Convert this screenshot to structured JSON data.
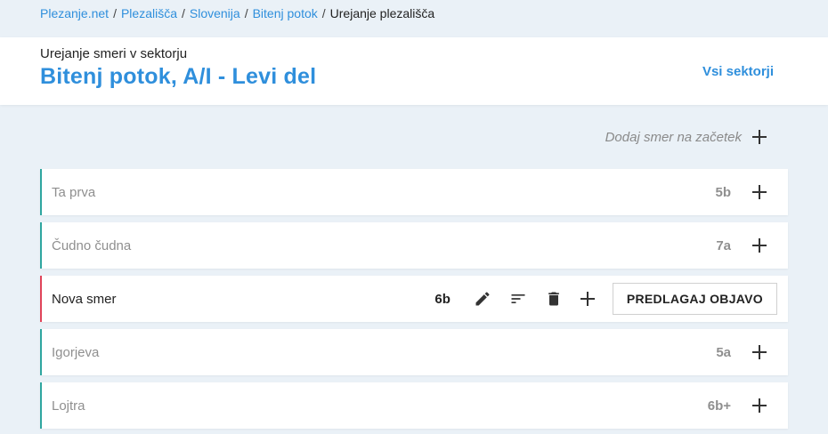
{
  "breadcrumb": {
    "items": [
      "Plezanje.net",
      "Plezališča",
      "Slovenija",
      "Bitenj potok"
    ],
    "current": "Urejanje plezališča",
    "separator": "/"
  },
  "header": {
    "subtitle": "Urejanje smeri v sektorju",
    "title": "Bitenj potok, A/I - Levi del",
    "all_sectors": "Vsi sektorji"
  },
  "add_start": {
    "label": "Dodaj smer na začetek",
    "icon": "plus-icon"
  },
  "routes": [
    {
      "name": "Ta prva",
      "grade": "5b"
    },
    {
      "name": "Čudno čudna",
      "grade": "7a"
    },
    {
      "name": "Nova smer",
      "grade": "6b",
      "active": true,
      "publish_label": "PREDLAGAJ OBJAVO"
    },
    {
      "name": "Igorjeva",
      "grade": "5a"
    },
    {
      "name": "Lojtra",
      "grade": "6b+"
    }
  ],
  "colors": {
    "accent": "#2f8fdc",
    "route_border": "#2fa6a0",
    "active_border": "#e0445a",
    "background": "#eaf1f7"
  }
}
